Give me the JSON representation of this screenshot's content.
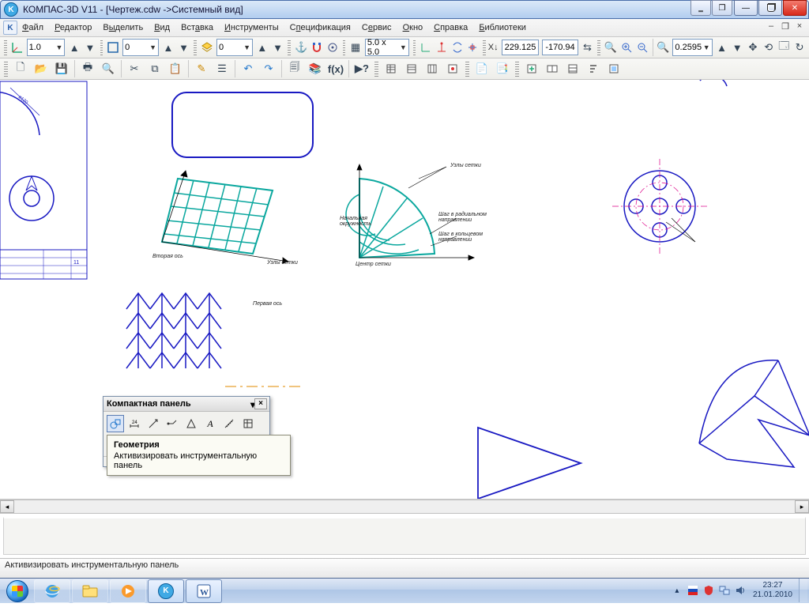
{
  "window": {
    "title": "КОМПАС-3D V11 - [Чертеж.cdw ->Системный вид]"
  },
  "menu": {
    "file": "Файл",
    "edit": "Редактор",
    "select": "Выделить",
    "view": "Вид",
    "insert": "Вставка",
    "tools": "Инструменты",
    "spec": "Спецификация",
    "service": "Сервис",
    "window": "Окно",
    "help": "Справка",
    "libs": "Библиотеки"
  },
  "tb1": {
    "scale": "1.0",
    "linetype": "0",
    "grid": "5.0 x 5.0",
    "coord_x": "229.125",
    "coord_y": "-170.94",
    "zoom": "0.2595"
  },
  "panel": {
    "title": "Компактная панель"
  },
  "tooltip": {
    "title": "Геометрия",
    "body": "Активизировать инструментальную панель"
  },
  "status": {
    "text": "Активизировать инструментальную панель"
  },
  "tray": {
    "time": "23:27",
    "date": "21.01.2010"
  }
}
